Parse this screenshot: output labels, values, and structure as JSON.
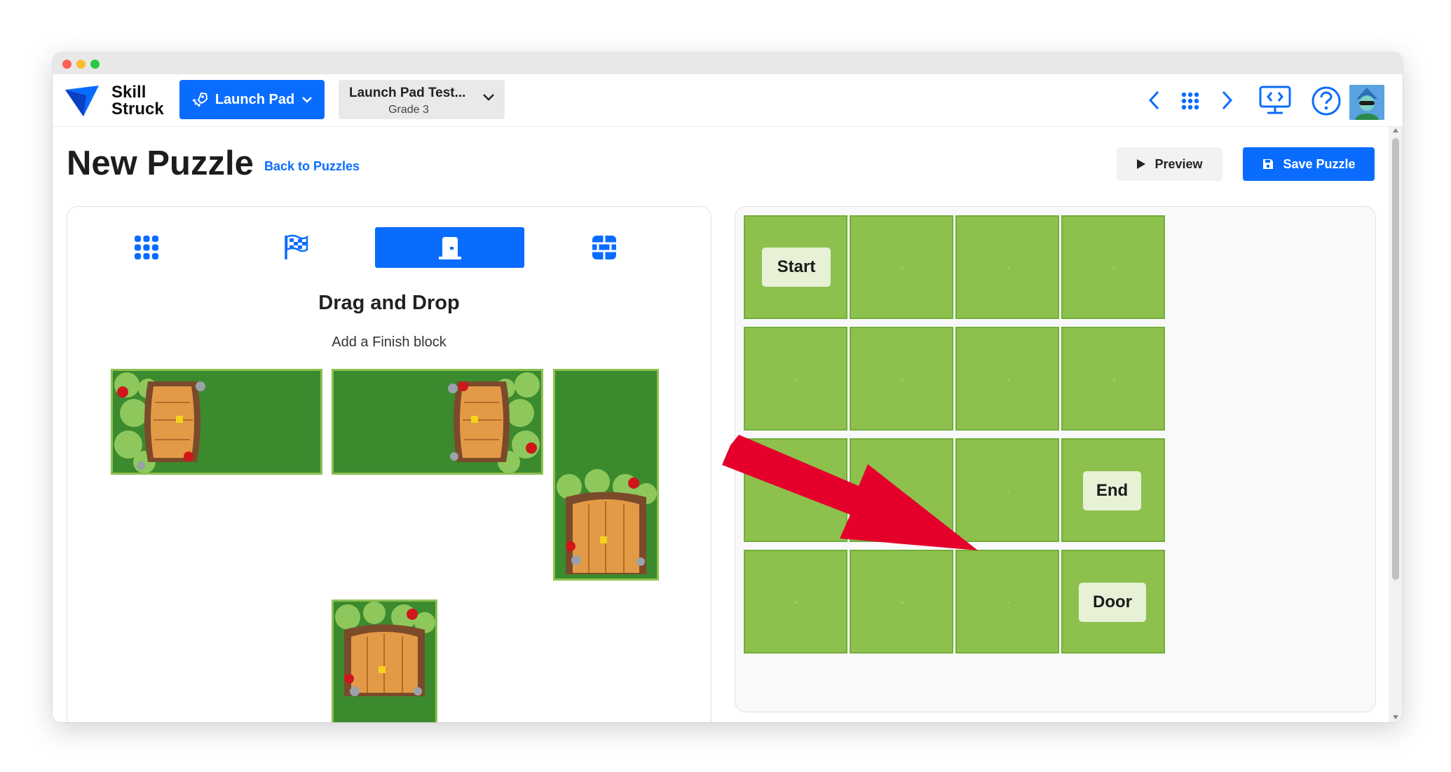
{
  "app": {
    "logo_line1": "Skill",
    "logo_line2": "Struck"
  },
  "header": {
    "launch_label": "Launch Pad",
    "class_title": "Launch Pad Test...",
    "class_grade": "Grade 3"
  },
  "icons": {
    "rocket": "rocket-icon",
    "prev": "chevron-left-icon",
    "apps": "grid-icon",
    "next": "chevron-right-icon",
    "present": "monitor-code-icon",
    "help": "help-icon"
  },
  "page": {
    "title": "New Puzzle",
    "back_link": "Back to Puzzles",
    "preview_label": "Preview",
    "save_label": "Save Puzzle"
  },
  "left_panel": {
    "tabs": [
      "grid-tab",
      "finish-flag-tab",
      "door-tab",
      "wall-tab"
    ],
    "active_tab": 2,
    "heading": "Drag and Drop",
    "subheading": "Add a Finish block"
  },
  "board": {
    "rows": 4,
    "cols": 4,
    "labels": {
      "start": "Start",
      "end": "End",
      "door": "Door"
    }
  },
  "colors": {
    "accent": "#0a6cff",
    "grass": "#8dc04d",
    "annotation_arrow": "#e4002b"
  }
}
